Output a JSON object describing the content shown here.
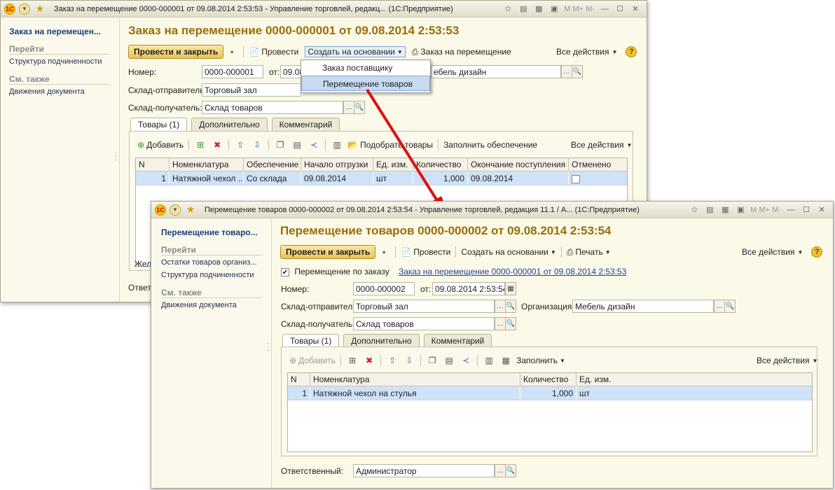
{
  "win1": {
    "title": "Заказ на перемещение 0000-000001 от 09.08.2014 2:53:53 - Управление торговлей, редакц... (1С:Предприятие)",
    "tbar_mem": "M  M+  M-",
    "sidebar": {
      "current": "Заказ на перемещен...",
      "goto_header": "Перейти",
      "goto_items": [
        "Структура подчиненности"
      ],
      "see_also_header": "См. также",
      "see_also_items": [
        "Движения документа"
      ]
    },
    "header": "Заказ на перемещение 0000-000001 от 09.08.2014 2:53:53",
    "toolbar": {
      "post_close": "Провести и закрыть",
      "post": "Провести",
      "create_based": "Создать на основании",
      "order_transfer": "Заказ на перемещение",
      "all_actions": "Все действия"
    },
    "dropdown": {
      "items": [
        "Заказ поставщику",
        "Перемещение товаров"
      ],
      "highlighted": "Перемещение товаров"
    },
    "form": {
      "number_label": "Номер:",
      "number": "0000-000001",
      "from_label": "от:",
      "date_partial": "09.08",
      "org_partial": "ебель дизайн",
      "sender_label": "Склад-отправитель:",
      "sender": "Торговый зал",
      "receiver_label": "Склад-получатель:",
      "receiver": "Склад товаров"
    },
    "tabs": [
      "Товары (1)",
      "Дополнительно",
      "Комментарий"
    ],
    "grid_toolbar": {
      "add": "Добавить",
      "pick": "Подобрать товары",
      "fill_supply": "Заполнить обеспечение",
      "all_actions": "Все действия"
    },
    "columns": [
      "N",
      "Номенклатура",
      "Обеспечение",
      "Начало отгрузки",
      "Ед. изм.",
      "Количество",
      "Окончание поступления",
      "Отменено"
    ],
    "rows": [
      {
        "n": "1",
        "item": "Натяжной чехол ...",
        "supply": "Со склада",
        "start": "09.08.2014",
        "unit": "шт",
        "qty": "1,000",
        "end": "09.08.2014"
      }
    ],
    "clipped_labels": [
      "Жел",
      "Ответ"
    ]
  },
  "win2": {
    "title": "Перемещение товаров 0000-000002 от 09.08.2014 2:53:54 - Управление торговлей, редакция 11.1 / А... (1С:Предприятие)",
    "tbar_mem": "M  M+  M-",
    "sidebar": {
      "current": "Перемещение товаро...",
      "goto_header": "Перейти",
      "goto_items": [
        "Остатки товаров организ...",
        "Структура подчиненности"
      ],
      "see_also_header": "См. также",
      "see_also_items": [
        "Движения документа"
      ]
    },
    "header": "Перемещение товаров 0000-000002 от 09.08.2014 2:53:54",
    "toolbar": {
      "post_close": "Провести и закрыть",
      "post": "Провести",
      "create_based": "Создать на основании",
      "print": "Печать",
      "all_actions": "Все действия"
    },
    "form": {
      "by_order_label": "Перемещение по заказу",
      "by_order_link": "Заказ на перемещение 0000-000001 от 09.08.2014 2:53:53",
      "number_label": "Номер:",
      "number": "0000-000002",
      "from_label": "от:",
      "date": "09.08.2014  2:53:54",
      "sender_label": "Склад-отправитель:",
      "sender": "Торговый зал",
      "org_label": "Организация:",
      "org": "Мебель дизайн",
      "receiver_label": "Склад-получатель:",
      "receiver": "Склад товаров",
      "responsible_label": "Ответственный:",
      "responsible": "Администратор"
    },
    "tabs": [
      "Товары (1)",
      "Дополнительно",
      "Комментарий"
    ],
    "grid_toolbar": {
      "add": "Добавить",
      "fill": "Заполнить",
      "all_actions": "Все действия"
    },
    "columns": [
      "N",
      "Номенклатура",
      "Количество",
      "Ед. изм."
    ],
    "rows": [
      {
        "n": "1",
        "item": "Натяжной чехол на стулья",
        "qty": "1,000",
        "unit": "шт"
      }
    ]
  },
  "colors": {
    "accent_header": "#9a6d08",
    "selection": "#cfe2f7",
    "arrow": "#e01010",
    "window_bg": "#fbf9e8"
  },
  "icons": [
    "1c-logo-icon",
    "dropdown-icon",
    "star-icon",
    "save-icon",
    "post-icon",
    "print-icon",
    "help-icon",
    "add-icon",
    "delete-icon",
    "up-arrow-icon",
    "down-arrow-icon",
    "copy-icon",
    "paste-icon",
    "barcode-icon",
    "search-icon",
    "ellipsis-icon",
    "calendar-icon",
    "minimize-icon",
    "maximize-icon",
    "close-icon"
  ]
}
